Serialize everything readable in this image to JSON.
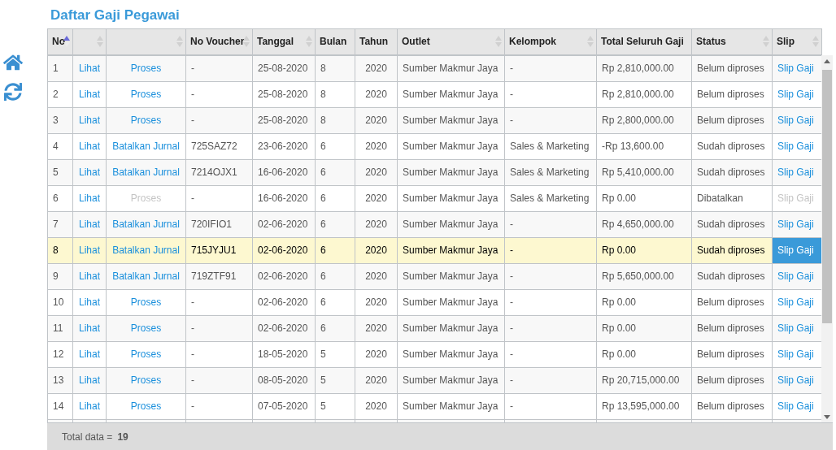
{
  "title": "Daftar Gaji Pegawai",
  "columns": [
    {
      "label": "No",
      "sortable": true,
      "sorted": true
    },
    {
      "sortable": true,
      "sorted": false
    },
    {
      "sortable": true,
      "sorted": false
    },
    {
      "label": "No Voucher",
      "sortable": true,
      "sorted": false
    },
    {
      "label": "Tanggal",
      "sortable": true,
      "sorted": false
    },
    {
      "label": "Bulan",
      "sortable": false
    },
    {
      "label": "Tahun",
      "sortable": false
    },
    {
      "label": "Outlet",
      "sortable": true,
      "sorted": false
    },
    {
      "label": "Kelompok",
      "sortable": true,
      "sorted": false
    },
    {
      "label": "Total Seluruh Gaji",
      "sortable": false
    },
    {
      "label": "Status",
      "sortable": true,
      "sorted": false
    },
    {
      "label": "Slip",
      "sortable": true,
      "sorted": false
    }
  ],
  "rows": [
    {
      "no": "1",
      "view": "Lihat",
      "action": {
        "label": "Proses",
        "disabled": false
      },
      "voucher": "-",
      "date": "25-08-2020",
      "month": "8",
      "year": "2020",
      "outlet": "Sumber Makmur Jaya",
      "group": "-",
      "total": "Rp 2,810,000.00",
      "status": "Belum diproses",
      "slip": {
        "label": "Slip Gaji",
        "disabled": false
      },
      "selected": false
    },
    {
      "no": "2",
      "view": "Lihat",
      "action": {
        "label": "Proses",
        "disabled": false
      },
      "voucher": "-",
      "date": "25-08-2020",
      "month": "8",
      "year": "2020",
      "outlet": "Sumber Makmur Jaya",
      "group": "-",
      "total": "Rp 2,810,000.00",
      "status": "Belum diproses",
      "slip": {
        "label": "Slip Gaji",
        "disabled": false
      },
      "selected": false
    },
    {
      "no": "3",
      "view": "Lihat",
      "action": {
        "label": "Proses",
        "disabled": false
      },
      "voucher": "-",
      "date": "25-08-2020",
      "month": "8",
      "year": "2020",
      "outlet": "Sumber Makmur Jaya",
      "group": "-",
      "total": "Rp 2,800,000.00",
      "status": "Belum diproses",
      "slip": {
        "label": "Slip Gaji",
        "disabled": false
      },
      "selected": false
    },
    {
      "no": "4",
      "view": "Lihat",
      "action": {
        "label": "Batalkan Jurnal",
        "disabled": false
      },
      "voucher": "725SAZ72",
      "date": "23-06-2020",
      "month": "6",
      "year": "2020",
      "outlet": "Sumber Makmur Jaya",
      "group": "Sales & Marketing",
      "total": "-Rp 13,600.00",
      "status": "Sudah diproses",
      "slip": {
        "label": "Slip Gaji",
        "disabled": false
      },
      "selected": false
    },
    {
      "no": "5",
      "view": "Lihat",
      "action": {
        "label": "Batalkan Jurnal",
        "disabled": false
      },
      "voucher": "7214OJX1",
      "date": "16-06-2020",
      "month": "6",
      "year": "2020",
      "outlet": "Sumber Makmur Jaya",
      "group": "Sales & Marketing",
      "total": "Rp 5,410,000.00",
      "status": "Sudah diproses",
      "slip": {
        "label": "Slip Gaji",
        "disabled": false
      },
      "selected": false
    },
    {
      "no": "6",
      "view": "Lihat",
      "action": {
        "label": "Proses",
        "disabled": true
      },
      "voucher": "-",
      "date": "16-06-2020",
      "month": "6",
      "year": "2020",
      "outlet": "Sumber Makmur Jaya",
      "group": "Sales & Marketing",
      "total": "Rp 0.00",
      "status": "Dibatalkan",
      "slip": {
        "label": "Slip Gaji",
        "disabled": true
      },
      "selected": false
    },
    {
      "no": "7",
      "view": "Lihat",
      "action": {
        "label": "Batalkan Jurnal",
        "disabled": false
      },
      "voucher": "720IFIO1",
      "date": "02-06-2020",
      "month": "6",
      "year": "2020",
      "outlet": "Sumber Makmur Jaya",
      "group": "-",
      "total": "Rp 4,650,000.00",
      "status": "Sudah diproses",
      "slip": {
        "label": "Slip Gaji",
        "disabled": false
      },
      "selected": false
    },
    {
      "no": "8",
      "view": "Lihat",
      "action": {
        "label": "Batalkan Jurnal",
        "disabled": false
      },
      "voucher": "715JYJU1",
      "date": "02-06-2020",
      "month": "6",
      "year": "2020",
      "outlet": "Sumber Makmur Jaya",
      "group": "-",
      "total": "Rp 0.00",
      "status": "Sudah diproses",
      "slip": {
        "label": "Slip Gaji",
        "disabled": false
      },
      "selected": true
    },
    {
      "no": "9",
      "view": "Lihat",
      "action": {
        "label": "Batalkan Jurnal",
        "disabled": false
      },
      "voucher": "719ZTF91",
      "date": "02-06-2020",
      "month": "6",
      "year": "2020",
      "outlet": "Sumber Makmur Jaya",
      "group": "-",
      "total": "Rp 5,650,000.00",
      "status": "Sudah diproses",
      "slip": {
        "label": "Slip Gaji",
        "disabled": false
      },
      "selected": false
    },
    {
      "no": "10",
      "view": "Lihat",
      "action": {
        "label": "Proses",
        "disabled": false
      },
      "voucher": "-",
      "date": "02-06-2020",
      "month": "6",
      "year": "2020",
      "outlet": "Sumber Makmur Jaya",
      "group": "-",
      "total": "Rp 0.00",
      "status": "Belum diproses",
      "slip": {
        "label": "Slip Gaji",
        "disabled": false
      },
      "selected": false
    },
    {
      "no": "11",
      "view": "Lihat",
      "action": {
        "label": "Proses",
        "disabled": false
      },
      "voucher": "-",
      "date": "02-06-2020",
      "month": "6",
      "year": "2020",
      "outlet": "Sumber Makmur Jaya",
      "group": "-",
      "total": "Rp 0.00",
      "status": "Belum diproses",
      "slip": {
        "label": "Slip Gaji",
        "disabled": false
      },
      "selected": false
    },
    {
      "no": "12",
      "view": "Lihat",
      "action": {
        "label": "Proses",
        "disabled": false
      },
      "voucher": "-",
      "date": "18-05-2020",
      "month": "5",
      "year": "2020",
      "outlet": "Sumber Makmur Jaya",
      "group": "-",
      "total": "Rp 0.00",
      "status": "Belum diproses",
      "slip": {
        "label": "Slip Gaji",
        "disabled": false
      },
      "selected": false
    },
    {
      "no": "13",
      "view": "Lihat",
      "action": {
        "label": "Proses",
        "disabled": false
      },
      "voucher": "-",
      "date": "08-05-2020",
      "month": "5",
      "year": "2020",
      "outlet": "Sumber Makmur Jaya",
      "group": "-",
      "total": "Rp 20,715,000.00",
      "status": "Belum diproses",
      "slip": {
        "label": "Slip Gaji",
        "disabled": false
      },
      "selected": false
    },
    {
      "no": "14",
      "view": "Lihat",
      "action": {
        "label": "Proses",
        "disabled": false
      },
      "voucher": "-",
      "date": "07-05-2020",
      "month": "5",
      "year": "2020",
      "outlet": "Sumber Makmur Jaya",
      "group": "-",
      "total": "Rp 13,595,000.00",
      "status": "Belum diproses",
      "slip": {
        "label": "Slip Gaji",
        "disabled": false
      },
      "selected": false
    }
  ],
  "footer": {
    "label": "Total data =",
    "count": "19"
  }
}
